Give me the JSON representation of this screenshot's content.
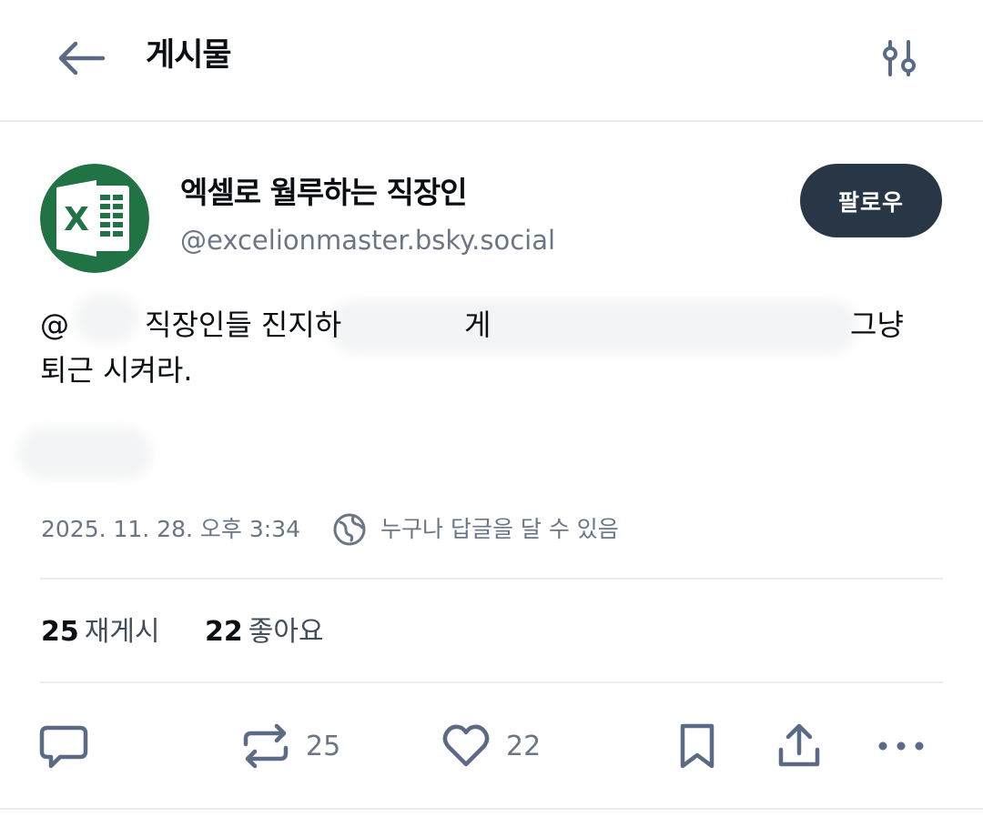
{
  "header": {
    "title": "게시물",
    "back_icon": "arrow-left-icon",
    "filter_icon": "sliders-icon"
  },
  "author": {
    "display_name": "엑셀로 월루하는 직장인",
    "handle": "@excelionmaster.bsky.social",
    "avatar_icon": "excel-logo-icon",
    "avatar_letter": "X",
    "avatar_color": "#217346"
  },
  "follow_button": {
    "label": "팔로우",
    "color": "#283646"
  },
  "post": {
    "segments": [
      "@",
      "직장인들 진지하",
      "게",
      "그냥"
    ],
    "line2": "퇴근 시켜라."
  },
  "meta": {
    "timestamp": "2025. 11. 28. 오후 3:34",
    "reply_setting": "누구나 답글을 달 수 있음",
    "globe_icon": "globe-icon"
  },
  "stats": {
    "reposts_count": "25",
    "reposts_label": "재게시",
    "likes_count": "22",
    "likes_label": "좋아요"
  },
  "actions": {
    "reply_icon": "reply-icon",
    "repost_icon": "repost-icon",
    "repost_count": "25",
    "like_icon": "heart-icon",
    "like_count": "22",
    "bookmark_icon": "bookmark-icon",
    "share_icon": "share-icon",
    "more_icon": "more-icon"
  },
  "colors": {
    "text_primary": "#0b0f14",
    "text_secondary": "#6b7684",
    "icon": "#5b6b86",
    "divider": "#e9edf1"
  }
}
